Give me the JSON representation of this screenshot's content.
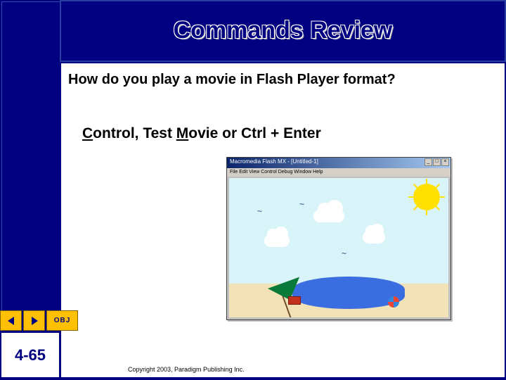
{
  "header": {
    "title": "Commands Review"
  },
  "content": {
    "question": "How do you play a movie in Flash Player format?",
    "answer_parts": {
      "c": "C",
      "ontrol": "ontrol, Test ",
      "m": "M",
      "ovie": "ovie or Ctrl + Enter"
    }
  },
  "flash_window": {
    "title": "Macromedia Flash MX - [Untitled-1]",
    "menu": "File  Edit  View  Control  Debug  Window  Help",
    "buttons": {
      "min": "_",
      "max": "□",
      "close": "×"
    }
  },
  "nav": {
    "obj_label": "OBJ"
  },
  "footer": {
    "slide_number": "4-65",
    "copyright": "Copyright 2003, Paradigm Publishing Inc."
  }
}
